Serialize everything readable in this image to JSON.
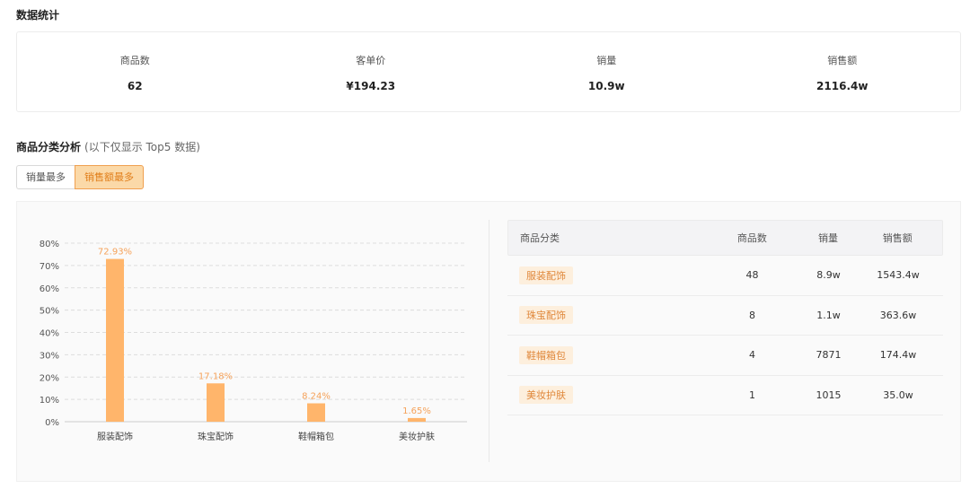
{
  "stats": {
    "title": "数据统计",
    "items": [
      {
        "label": "商品数",
        "value": "62"
      },
      {
        "label": "客单价",
        "value": "¥194.23"
      },
      {
        "label": "销量",
        "value": "10.9w"
      },
      {
        "label": "销售额",
        "value": "2116.4w"
      }
    ]
  },
  "category": {
    "title": "商品分类分析",
    "note": "(以下仅显示 Top5 数据)",
    "toggle": {
      "sales_volume": "销量最多",
      "sales_amount": "销售额最多",
      "active": "sales_amount"
    }
  },
  "chart_data": {
    "type": "bar",
    "categories": [
      "服装配饰",
      "珠宝配饰",
      "鞋帽箱包",
      "美妆护肤"
    ],
    "values": [
      72.93,
      17.18,
      8.24,
      1.65
    ],
    "data_labels": [
      "72.93%",
      "17.18%",
      "8.24%",
      "1.65%"
    ],
    "ylim": [
      0,
      80
    ],
    "yticks": [
      "0%",
      "10%",
      "20%",
      "30%",
      "40%",
      "50%",
      "60%",
      "70%",
      "80%"
    ],
    "grid": true,
    "bar_color": "#ffb56b",
    "label_color": "#f5a25a"
  },
  "table": {
    "headers": [
      "商品分类",
      "商品数",
      "销量",
      "销售额"
    ],
    "rows": [
      {
        "category": "服装配饰",
        "count": "48",
        "volume": "8.9w",
        "amount": "1543.4w"
      },
      {
        "category": "珠宝配饰",
        "count": "8",
        "volume": "1.1w",
        "amount": "363.6w"
      },
      {
        "category": "鞋帽箱包",
        "count": "4",
        "volume": "7871",
        "amount": "174.4w"
      },
      {
        "category": "美妆护肤",
        "count": "1",
        "volume": "1015",
        "amount": "35.0w"
      }
    ]
  }
}
